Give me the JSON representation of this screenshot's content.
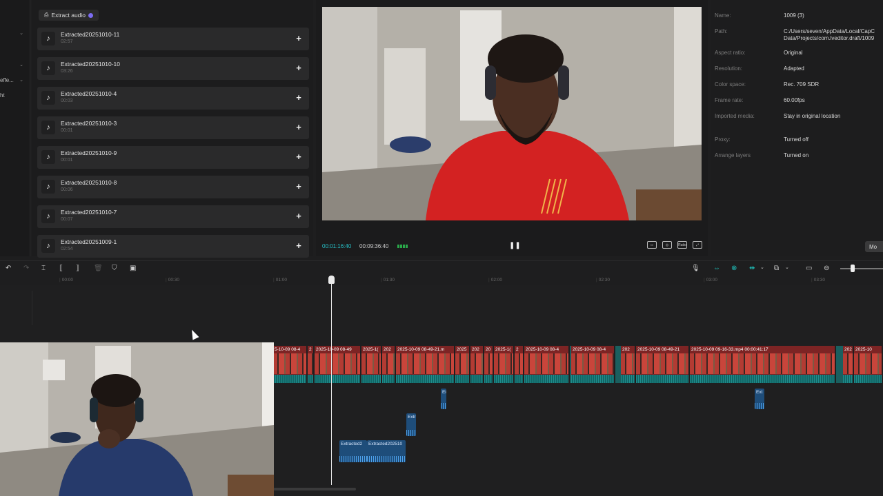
{
  "left_strip": {
    "items": [
      "",
      "",
      "",
      "",
      "effe...",
      "",
      "ht"
    ]
  },
  "media_panel": {
    "extract_audio_label": "Extract audio",
    "items": [
      {
        "name": "Extracted20251010-11",
        "duration": "02:57"
      },
      {
        "name": "Extracted20251010-10",
        "duration": "03:26"
      },
      {
        "name": "Extracted20251010-4",
        "duration": "00:03"
      },
      {
        "name": "Extracted20251010-3",
        "duration": "00:01"
      },
      {
        "name": "Extracted20251010-9",
        "duration": "00:01"
      },
      {
        "name": "Extracted20251010-8",
        "duration": "00:06"
      },
      {
        "name": "Extracted20251010-7",
        "duration": "00:07"
      },
      {
        "name": "Extracted20251009-1",
        "duration": "02:54"
      }
    ]
  },
  "preview": {
    "current_time": "00:01:16:40",
    "total_time": "00:09:36:40",
    "ratio_label": "Ratio"
  },
  "details": {
    "rows": [
      {
        "label": "Name:",
        "value": "1009 (3)"
      },
      {
        "label": "Path:",
        "value": "C:/Users/seven/AppData/Local/CapC\nData/Projects/com.lveditor.draft/1009"
      },
      {
        "label": "Aspect ratio:",
        "value": "Original"
      },
      {
        "label": "Resolution:",
        "value": "Adapted"
      },
      {
        "label": "Color space:",
        "value": "Rec. 709 SDR"
      },
      {
        "label": "Frame rate:",
        "value": "60.00fps"
      },
      {
        "label": "Imported media:",
        "value": "Stay in original location"
      },
      {
        "label": "Proxy:",
        "value": "Turned off"
      },
      {
        "label": "Arrange layers",
        "value": "Turned on"
      }
    ],
    "more_label": "Mo"
  },
  "ruler": {
    "ticks": [
      "00:00",
      "00:30",
      "01:00",
      "01:30",
      "02:00",
      "02:30",
      "03:00",
      "03:30"
    ]
  },
  "timeline": {
    "main_clips": [
      "5-10-09 08-4",
      "2",
      "2025-10-09 08-49",
      "2025-1(",
      "202",
      "2025-10-09 08-49-21.m",
      "2025",
      "202",
      "20",
      "2025-1(",
      "2",
      "2025-10-09 08-4",
      "2025-10-09 08-4",
      "202",
      "2025-10-09 08-49-21",
      "2025-10-09 09-16-33.mp4  00:00:41:17",
      "202",
      "2025-10"
    ],
    "audio_clips": [
      "Ei",
      "Ext",
      "Extr",
      "Extracted2",
      "Extracted202510"
    ]
  },
  "colors": {
    "accent_teal": "#1fc7c1",
    "timecode": "#27c2c9",
    "audio_clip": "#1e4d7a"
  }
}
